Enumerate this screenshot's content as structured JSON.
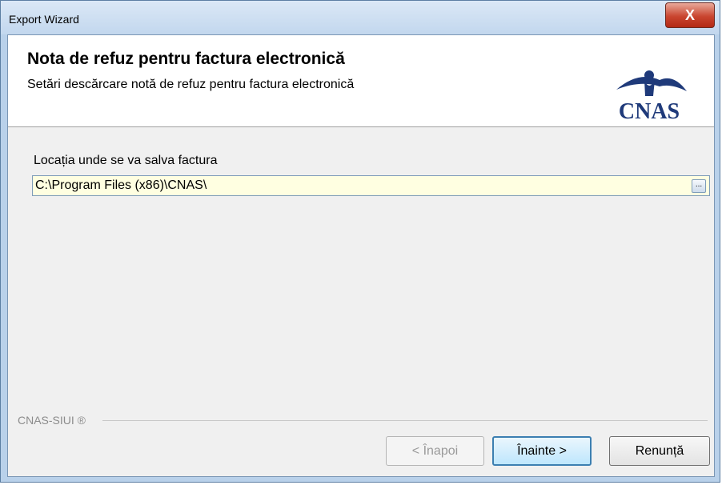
{
  "window": {
    "title": "Export Wizard",
    "close_glyph": "X"
  },
  "header": {
    "title": "Nota de refuz pentru factura electronică",
    "subtitle": "Setări descărcare notă de refuz pentru factura electronică",
    "logo_text": "CNAS",
    "logo_color": "#1f3a7a"
  },
  "form": {
    "location_label": "Locația unde se va salva factura",
    "location_value": "C:\\Program Files (x86)\\CNAS\\",
    "browse_label": "...",
    "field_background": "#ffffe1"
  },
  "footer": {
    "brand": "CNAS-SIUI ®"
  },
  "buttons": {
    "back": "< Înapoi",
    "next": "Înainte >",
    "cancel": "Renunță",
    "back_enabled": false
  },
  "colors": {
    "close_red": "#c9452f",
    "title_bar": "#c2d7ee",
    "default_button_border": "#3c7fb1"
  }
}
